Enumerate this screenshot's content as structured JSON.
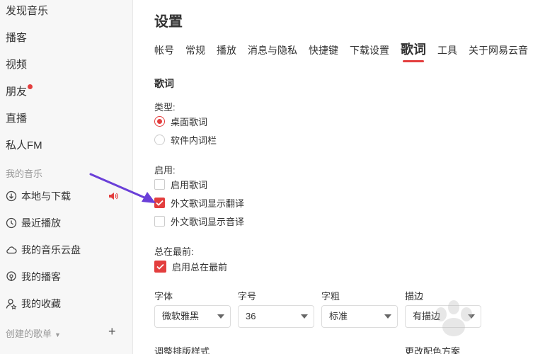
{
  "sidebar": {
    "nav": [
      {
        "label": "发现音乐"
      },
      {
        "label": "播客"
      },
      {
        "label": "视频"
      },
      {
        "label": "朋友"
      },
      {
        "label": "直播"
      },
      {
        "label": "私人FM"
      }
    ],
    "my_music_title": "我的音乐",
    "my_items": [
      {
        "label": "本地与下载",
        "icon": "download-icon"
      },
      {
        "label": "最近播放",
        "icon": "clock-icon"
      },
      {
        "label": "我的音乐云盘",
        "icon": "cloud-icon"
      },
      {
        "label": "我的播客",
        "icon": "podcast-icon"
      },
      {
        "label": "我的收藏",
        "icon": "user-star-icon"
      }
    ],
    "created_playlists_title": "创建的歌单"
  },
  "main": {
    "title": "设置",
    "tabs": [
      {
        "label": "帐号"
      },
      {
        "label": "常规"
      },
      {
        "label": "播放"
      },
      {
        "label": "消息与隐私"
      },
      {
        "label": "快捷键"
      },
      {
        "label": "下载设置"
      },
      {
        "label": "歌词",
        "active": true
      },
      {
        "label": "工具"
      },
      {
        "label": "关于网易云音"
      }
    ],
    "lyrics": {
      "heading": "歌词",
      "type_label": "类型:",
      "type_options": [
        {
          "label": "桌面歌词",
          "selected": true
        },
        {
          "label": "软件内词栏",
          "selected": false
        }
      ],
      "enable_label": "启用:",
      "enable_options": [
        {
          "label": "启用歌词",
          "checked": false
        },
        {
          "label": "外文歌词显示翻译",
          "checked": true
        },
        {
          "label": "外文歌词显示音译",
          "checked": false
        }
      ],
      "ontop_label": "总在最前:",
      "ontop_option": {
        "label": "启用总在最前",
        "checked": true
      },
      "font_label": "字体",
      "font_value": "微软雅黑",
      "size_label": "字号",
      "size_value": "36",
      "weight_label": "字粗",
      "weight_value": "标准",
      "stroke_label": "描边",
      "stroke_value": "有描边",
      "layout_label": "调整排版样式",
      "color_label": "更改配色方案"
    }
  },
  "colors": {
    "accent": "#e33e3e",
    "annotation_arrow": "#6a3fd8"
  }
}
